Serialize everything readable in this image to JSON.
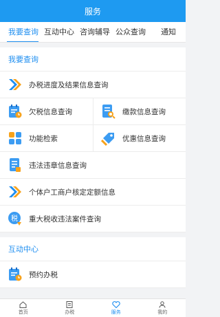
{
  "header": {
    "title": "服务"
  },
  "tabs": [
    {
      "label": "我要查询"
    },
    {
      "label": "互动中心"
    },
    {
      "label": "咨询辅导"
    },
    {
      "label": "公众查询"
    },
    {
      "label": "通知"
    }
  ],
  "section_query": {
    "title": "我要查询",
    "items": [
      {
        "label": "办税进度及结果信息查询",
        "icon": "double-chevron-icon"
      },
      {
        "label": "欠税信息查询",
        "icon": "calendar-clipboard-icon"
      },
      {
        "label": "缴款信息查询",
        "icon": "document-search-icon"
      },
      {
        "label": "功能检索",
        "icon": "grid-icon"
      },
      {
        "label": "优惠信息查询",
        "icon": "tag-icon"
      },
      {
        "label": "违法违章信息查询",
        "icon": "list-document-icon"
      },
      {
        "label": "个体户工商户核定定额信息",
        "icon": "double-chevron-icon"
      },
      {
        "label": "重大税收违法案件查询",
        "icon": "tax-circle-icon"
      }
    ]
  },
  "section_interact": {
    "title": "互动中心",
    "items": [
      {
        "label": "预约办税",
        "icon": "calendar-clipboard-icon"
      }
    ]
  },
  "tabbar": {
    "items": [
      {
        "label": "首页",
        "icon": "home-icon"
      },
      {
        "label": "办税",
        "icon": "book-icon"
      },
      {
        "label": "服务",
        "icon": "heart-icon"
      },
      {
        "label": "我的",
        "icon": "user-icon"
      }
    ]
  },
  "colors": {
    "primary": "#1e9af1",
    "accent": "#1e8ef0",
    "orange": "#f7a21b"
  }
}
